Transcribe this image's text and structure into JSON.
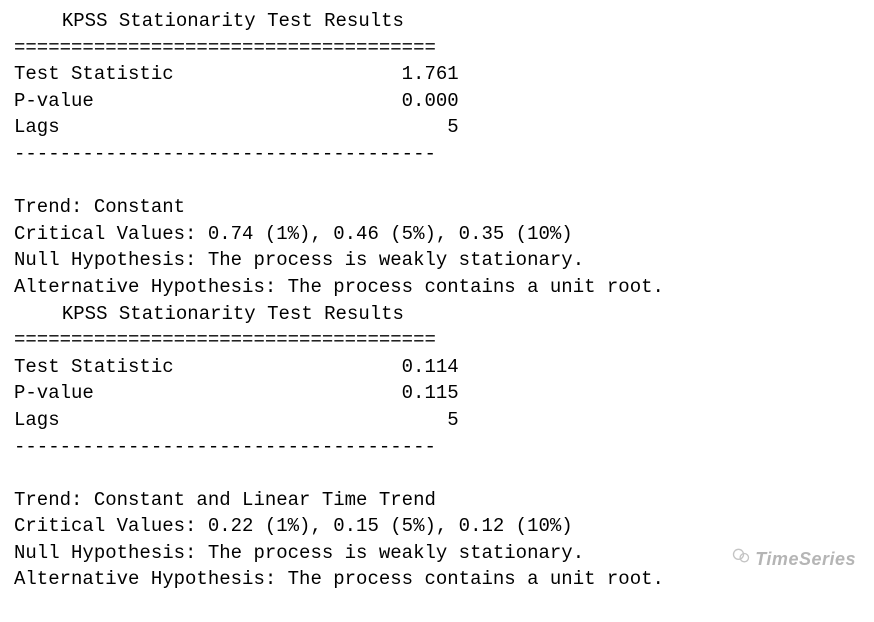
{
  "blocks": [
    {
      "title": "KPSS Stationarity Test Results",
      "sep_eq": "=====================================",
      "stats": [
        {
          "label": "Test Statistic",
          "value": "1.761"
        },
        {
          "label": "P-value",
          "value": "0.000"
        },
        {
          "label": "Lags",
          "value": "5"
        }
      ],
      "sep_dash": "-------------------------------------",
      "trend": "Trend: Constant",
      "critical_values": "Critical Values: 0.74 (1%), 0.46 (5%), 0.35 (10%)",
      "null_hypothesis": "Null Hypothesis: The process is weakly stationary.",
      "alt_hypothesis": "Alternative Hypothesis: The process contains a unit root."
    },
    {
      "title": "KPSS Stationarity Test Results",
      "sep_eq": "=====================================",
      "stats": [
        {
          "label": "Test Statistic",
          "value": "0.114"
        },
        {
          "label": "P-value",
          "value": "0.115"
        },
        {
          "label": "Lags",
          "value": "5"
        }
      ],
      "sep_dash": "-------------------------------------",
      "trend": "Trend: Constant and Linear Time Trend",
      "critical_values": "Critical Values: 0.22 (1%), 0.15 (5%), 0.12 (10%)",
      "null_hypothesis": "Null Hypothesis: The process is weakly stationary.",
      "alt_hypothesis": "Alternative Hypothesis: The process contains a unit root."
    }
  ],
  "watermark": "TimeSeries"
}
